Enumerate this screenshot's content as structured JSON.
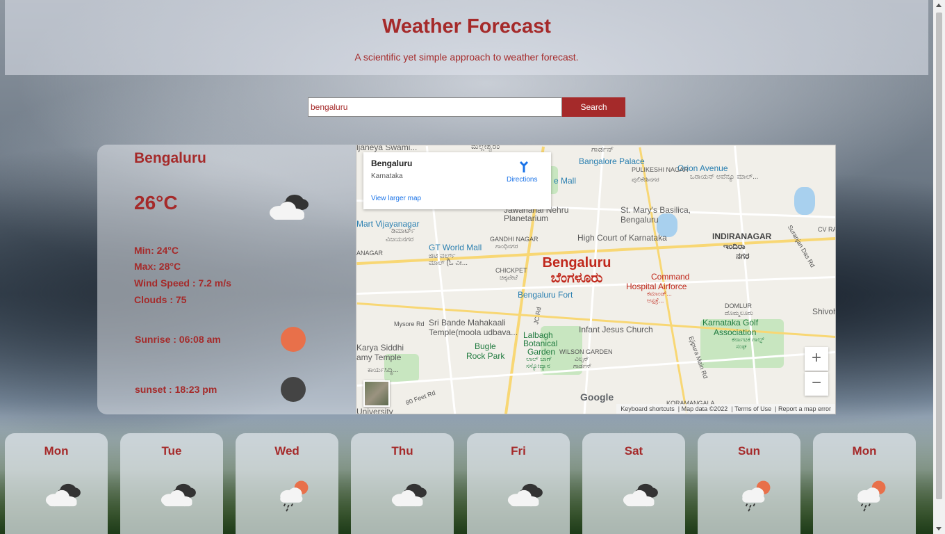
{
  "header": {
    "title": "Weather Forecast",
    "subtitle": "A scientific yet simple approach to weather forecast."
  },
  "search": {
    "value": "bengaluru",
    "button_label": "Search"
  },
  "current": {
    "city": "Bengaluru",
    "temperature": "26°C",
    "icon": "broken-clouds-icon",
    "min": "Min: 24°C",
    "max": "Max: 28°C",
    "wind": "Wind Speed : 7.2 m/s",
    "clouds": "Clouds : 75",
    "sunrise": "Sunrise : 06:08 am",
    "sunset": "sunset : 18:23 pm",
    "sunrise_color": "#e8704a",
    "sunset_color": "#444444"
  },
  "map": {
    "place_name": "Bengaluru",
    "place_region": "Karnataka",
    "directions_label": "Directions",
    "larger_map_label": "View larger map",
    "city_label": "Bengaluru",
    "city_label_kn": "ಬೆಂಗಳೂರು",
    "pois": {
      "bangalore_palace": "Bangalore Palace",
      "orion_avenue": "Orion Avenue",
      "orion_kn": "ಒರಾಯನ್ ಅವೆನ್ಯೂ ಮಾಲ್...",
      "pulikeshi": "PULIKESHI NAGAR",
      "pulikeshi_kn": "ಪುಲಿಕೇಶಿನಗರ",
      "mall": "e Mall",
      "stmarys": "St. Mary's Basilica,",
      "stmarys2": "Bengaluru",
      "planetarium": "Jawaharlal Nehru",
      "planetarium2": "Planetarium",
      "vijayanagar": "Mart Vijayanagar",
      "vijayanagar_kn1": "ಡಿಮಾರ್ಟ್",
      "vijayanagar_kn2": "ವಿಜಯನಗರ",
      "gandhinagar": "GANDHI NAGAR",
      "gandhinagar_kn": "ಗಾಂಧಿನಗರ",
      "highcourt": "High Court of Karnataka",
      "indiranagar": "INDIRANAGAR",
      "indiranagar_kn": "ಇಂದಿರಾ",
      "indiranagar_kn2": "ನಗರ",
      "cvraman": "CV RA",
      "gtmall": "GT World Mall",
      "gtmall_kn": "ಜಿಟಿ ವರ್ಲ್ಡ್",
      "gtmall_kn2": "ಮಾಲ್ (ಓ ವೀ...",
      "chickpet": "CHICKPET",
      "chickpet_kn": "ಚಿಕ್ಕಪೇಟೆ",
      "command": "Command",
      "command2": "Hospital Airforce",
      "command_kn": "ಕಮಾಂಡ್...",
      "command_kn2": "ಆಸ್ಪತ್ರೆ...",
      "nagar": "ANAGAR",
      "fort": "Bengaluru Fort",
      "domlur": "DOMLUR",
      "domlur_kn": "ದೊಮ್ಮಲೂರು",
      "shivoh": "Shivoh",
      "mysore_rd": "Mysore Rd",
      "jc_rd": "JC Rd",
      "kali": "Sri Bande Mahakaali",
      "kali2": "Temple(moola udbava...",
      "infant": "Infant Jesus Church",
      "golf": "Karnataka Golf",
      "golf2": "Association",
      "golf_kn": "ಕರ್ನಾಟಕ ಗಾಲ್ಫ್",
      "golf_kn2": "ಸಂಘ",
      "lalbagh": "Lalbagh",
      "lalbagh2": "Botanical",
      "lalbagh3": "Garden",
      "lalbagh_kn": "ಲಾಲ್ ಬಾಗ್",
      "lalbagh_kn2": "ಸಸ್ಯೋದ್ಯಾನ",
      "karya": "Karya Siddhi",
      "karya2": "amy Temple",
      "karya_kn": "ಕಾರ್ಯಸಿದ್ಧಿ...",
      "bugle": "Bugle",
      "bugle2": "Rock Park",
      "wilson": "WILSON GARDEN",
      "wilson_kn": "ವಿಲ್ಸನ್",
      "wilson_kn2": "ಗಾರ್ಡನ್",
      "ejipura": "Ejipura Main Rd",
      "suranjan": "Suranjan Das Rd",
      "ft80": "80 Feet Rd",
      "koramangala": "KORAMANGALA",
      "university": "University",
      "swami": "ljaneya Swami...",
      "gardan": "ಗಾರ್ಡನ್",
      "top_kn": "ಮಲ್ಲೇಶ್ವರಂ"
    },
    "zoom_in": "+",
    "zoom_out": "−",
    "google": "Google",
    "attribution": {
      "shortcuts": "Keyboard shortcuts",
      "data": "Map data ©2022",
      "terms": "Terms of Use",
      "report": "Report a map error"
    }
  },
  "forecast": [
    {
      "day": "Mon",
      "icon": "broken-clouds-icon"
    },
    {
      "day": "Tue",
      "icon": "broken-clouds-icon"
    },
    {
      "day": "Wed",
      "icon": "rain-icon"
    },
    {
      "day": "Thu",
      "icon": "broken-clouds-icon"
    },
    {
      "day": "Fri",
      "icon": "broken-clouds-icon"
    },
    {
      "day": "Sat",
      "icon": "broken-clouds-icon"
    },
    {
      "day": "Sun",
      "icon": "rain-icon"
    },
    {
      "day": "Mon",
      "icon": "rain-icon"
    }
  ]
}
